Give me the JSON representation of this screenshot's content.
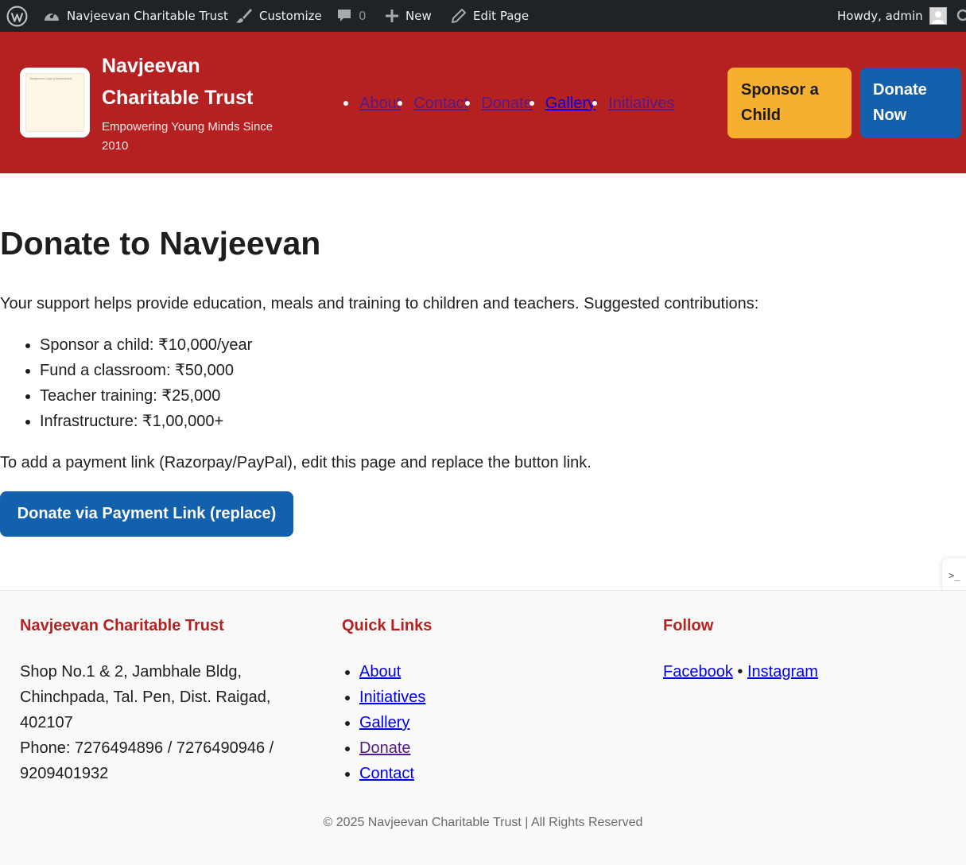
{
  "admin_bar": {
    "site_name": "Navjeevan Charitable Trust",
    "customize": "Customize",
    "comments_count": "0",
    "new": "New",
    "edit_page": "Edit Page",
    "howdy": "Howdy, admin"
  },
  "header": {
    "logo_placeholder": "Navjeevan Logo (placeholder)",
    "site_title": "Navjeevan Charitable Trust",
    "tagline": "Empowering Young Minds Since 2010",
    "nav": [
      "About",
      "Contact",
      "Donate",
      "Gallery",
      "Initiatives"
    ],
    "sponsor_button": "Sponsor a Child",
    "donate_button": "Donate Now"
  },
  "main": {
    "title": "Donate to Navjeevan",
    "intro": "Your support helps provide education, meals and training to children and teachers. Suggested contributions:",
    "contributions": [
      "Sponsor a child: ₹10,000/year",
      "Fund a classroom: ₹50,000",
      "Teacher training: ₹25,000",
      "Infrastructure: ₹1,00,000+"
    ],
    "payment_note": "To add a payment link (Razorpay/PayPal), edit this page and replace the button link.",
    "payment_button": "Donate via Payment Link (replace)"
  },
  "footer": {
    "org_heading": "Navjeevan Charitable Trust",
    "address_line1": "Shop No.1 & 2, Jambhale Bldg, Chinchpada, Tal. Pen, Dist. Raigad, 402107",
    "phone_line": "Phone: 7276494896 / 7276490946 / 9209401932",
    "quick_links_heading": "Quick Links",
    "quick_links": [
      "About",
      "Initiatives",
      "Gallery",
      "Donate",
      "Contact"
    ],
    "follow_heading": "Follow",
    "facebook": "Facebook",
    "separator": "•",
    "instagram": "Instagram",
    "copyright": "© 2025 Navjeevan Charitable Trust | All Rights Reserved"
  },
  "colors": {
    "admin_bar": "#1d2327",
    "brand_red": "#b52020",
    "sponsor_yellow": "#f7af30",
    "donate_blue": "#1360ad",
    "footer_bg": "#f9f9f9"
  },
  "icons": [
    "wordpress-logo-icon",
    "dashboard-icon",
    "paintbrush-icon",
    "comment-bubble-icon",
    "plus-icon",
    "pencil-icon",
    "avatar-icon",
    "search-icon"
  ]
}
